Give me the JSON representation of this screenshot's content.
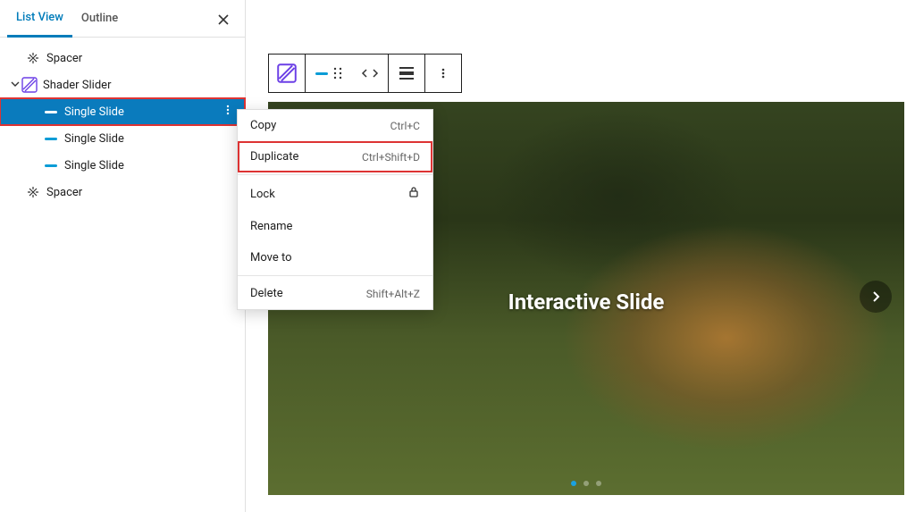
{
  "tabs": {
    "listView": "List View",
    "outline": "Outline"
  },
  "tree": {
    "spacer": "Spacer",
    "shaderSlider": "Shader Slider",
    "singleSlide": "Single Slide"
  },
  "contextMenu": {
    "copy": {
      "label": "Copy",
      "shortcut": "Ctrl+C"
    },
    "duplicate": {
      "label": "Duplicate",
      "shortcut": "Ctrl+Shift+D"
    },
    "lock": {
      "label": "Lock"
    },
    "rename": {
      "label": "Rename"
    },
    "moveTo": {
      "label": "Move to"
    },
    "delete": {
      "label": "Delete",
      "shortcut": "Shift+Alt+Z"
    }
  },
  "slide": {
    "title": "Interactive Slide"
  }
}
